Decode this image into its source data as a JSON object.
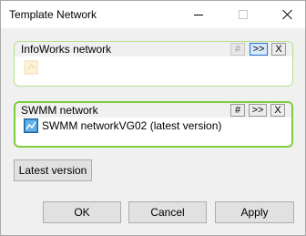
{
  "window": {
    "title": "Template Network"
  },
  "infoworks": {
    "label": "InfoWorks network",
    "hash_label": "#",
    "expand_label": ">>",
    "close_label": "X"
  },
  "swmm": {
    "label": "SWMM network",
    "hash_label": "#",
    "expand_label": ">>",
    "close_label": "X",
    "item_text": "SWMM networkVG02 (latest version)"
  },
  "buttons": {
    "latest_version": "Latest version",
    "ok": "OK",
    "cancel": "Cancel",
    "apply": "Apply"
  }
}
